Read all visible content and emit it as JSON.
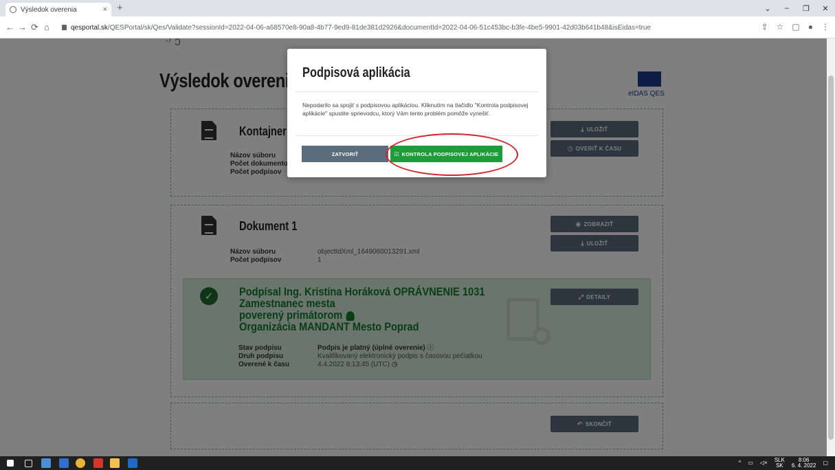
{
  "browser": {
    "tab_title": "Výsledok overenia",
    "tab_close": "×",
    "new_tab": "+",
    "url_host": "qesportal.sk",
    "url_path": "/QESPortal/sk/Qes/Validate?sessionId=2022-04-06-a68570e8-90a8-4b77-9ed9-81de381d2926&documentId=2022-04-06-51c453bc-b3fe-4be5-9901-42d03b641b48&isEidas=true",
    "window_controls": [
      "⌄",
      "–",
      "❐",
      "✕"
    ]
  },
  "page": {
    "title": "Výsledok overenia",
    "eidas_label": "eIDAS QES",
    "container": {
      "title": "Kontajner",
      "fields": [
        {
          "key": "Názov súboru",
          "value": ""
        },
        {
          "key": "Počet dokumentov",
          "value": ""
        },
        {
          "key": "Počet podpisov",
          "value": ""
        }
      ],
      "save_btn": "ULOŽIŤ",
      "verify_time_btn": "OVERIŤ K ČASU"
    },
    "document": {
      "title": "Dokument 1",
      "fields": [
        {
          "key": "Názov súboru",
          "value": "objectIdXml_1649060013291.xml"
        },
        {
          "key": "Počet podpisov",
          "value": "1"
        }
      ],
      "show_btn": "ZOBRAZIŤ",
      "save_btn": "ULOŽIŤ"
    },
    "signature": {
      "signer_line1": "Podpísal Ing. Kristína Horáková OPRÁVNENIE 1031 Zamestnanec mesta",
      "signer_line2": "poverený primátorom",
      "signer_line3": "Organizácia MANDANT Mesto Poprad",
      "details_btn": "DETAILY",
      "fields": [
        {
          "key": "Stav podpisu",
          "value": "Podpis je platný (úplné overenie)"
        },
        {
          "key": "Druh podpisu",
          "value": "Kvalifikovaný elektronický podpis s časovou pečiatkou"
        },
        {
          "key": "Overené k času",
          "value": "4.4.2022 8:13:45 (UTC)"
        }
      ]
    },
    "end_btn": "SKONČIŤ"
  },
  "modal": {
    "title": "Podpisová aplikácia",
    "body": "Nepodarilo sa spojiť s podpisovou aplikáciou. Kliknutím na tlačidlo \"Kontrola podpisovej aplikácie\" spustite sprievodcu, ktorý Vám tento problém pomôže vyriešiť.",
    "close_btn": "ZATVORIŤ",
    "check_btn": "KONTROLA PODPISOVEJ APLIKÁCIE"
  },
  "taskbar": {
    "lang_top": "SLK",
    "lang_bottom": "SK",
    "time": "8:06",
    "date": "6. 4. 2022"
  },
  "colors": {
    "primary_button": "#5b6c7d",
    "success_button": "#1f9c3a",
    "signature_bg": "#d4edda",
    "signature_text": "#137a2a",
    "highlight_ellipse": "#d2232a"
  }
}
